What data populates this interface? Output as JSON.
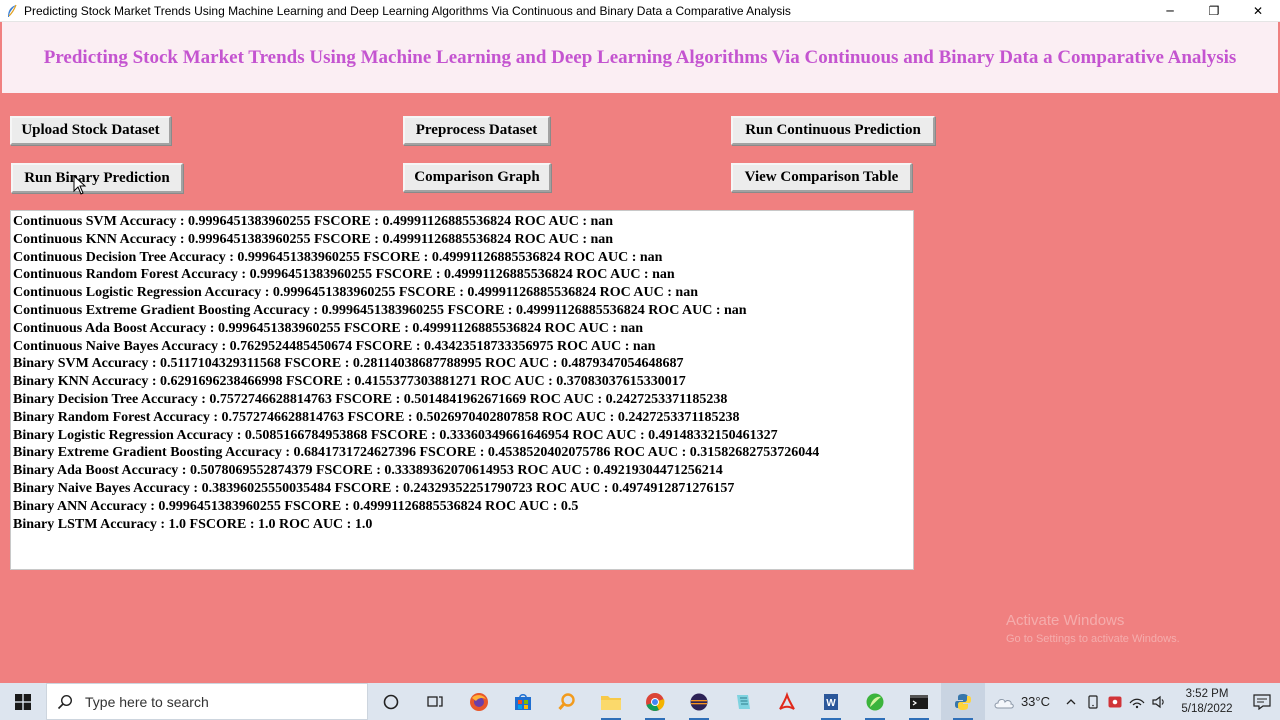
{
  "window": {
    "title": "Predicting Stock Market Trends Using Machine Learning and Deep Learning Algorithms Via Continuous and Binary Data a Comparative Analysis",
    "minimize": "─",
    "restore": "❐",
    "close": "✕"
  },
  "header": {
    "title": "Predicting Stock Market Trends Using Machine Learning and Deep Learning Algorithms Via Continuous and Binary Data a Comparative Analysis"
  },
  "buttons": {
    "upload": "Upload Stock Dataset",
    "preprocess": "Preprocess Dataset",
    "run_continuous": "Run Continuous Prediction",
    "run_binary": "Run Binary Prediction",
    "comparison_graph": "Comparison Graph",
    "comparison_table": "View Comparison Table"
  },
  "output": {
    "lines": [
      "Continuous SVM Accuracy : 0.9996451383960255 FSCORE : 0.49991126885536824 ROC AUC : nan",
      "Continuous KNN Accuracy : 0.9996451383960255 FSCORE : 0.49991126885536824 ROC AUC : nan",
      "Continuous Decision Tree Accuracy : 0.9996451383960255 FSCORE : 0.49991126885536824 ROC AUC : nan",
      "Continuous Random Forest Accuracy : 0.9996451383960255 FSCORE : 0.49991126885536824 ROC AUC : nan",
      "Continuous Logistic Regression Accuracy : 0.9996451383960255 FSCORE : 0.49991126885536824 ROC AUC : nan",
      "Continuous Extreme Gradient Boosting Accuracy : 0.9996451383960255 FSCORE : 0.49991126885536824 ROC AUC : nan",
      "Continuous Ada Boost Accuracy : 0.9996451383960255 FSCORE : 0.49991126885536824 ROC AUC : nan",
      "Continuous Naive Bayes Accuracy : 0.7629524485450674 FSCORE : 0.43423518733356975 ROC AUC : nan",
      "Binary SVM Accuracy : 0.5117104329311568 FSCORE : 0.28114038687788995 ROC AUC : 0.4879347054648687",
      "Binary KNN Accuracy : 0.6291696238466998 FSCORE : 0.4155377303881271 ROC AUC : 0.37083037615330017",
      "Binary Decision Tree Accuracy : 0.7572746628814763 FSCORE : 0.5014841962671669 ROC AUC : 0.2427253371185238",
      "Binary Random Forest Accuracy : 0.7572746628814763 FSCORE : 0.5026970402807858 ROC AUC : 0.2427253371185238",
      "Binary Logistic Regression Accuracy : 0.5085166784953868 FSCORE : 0.33360349661646954 ROC AUC : 0.49148332150461327",
      "Binary Extreme Gradient Boosting Accuracy : 0.6841731724627396 FSCORE : 0.4538520402075786 ROC AUC : 0.31582682753726044",
      "Binary Ada Boost Accuracy : 0.5078069552874379 FSCORE : 0.33389362070614953 ROC AUC : 0.49219304471256214",
      "Binary Naive Bayes Accuracy : 0.38396025550035484 FSCORE : 0.24329352251790723 ROC AUC : 0.4974912871276157",
      "Binary ANN Accuracy : 0.9996451383960255 FSCORE : 0.49991126885536824 ROC AUC : 0.5",
      "Binary LSTM Accuracy : 1.0 FSCORE : 1.0 ROC AUC : 1.0"
    ]
  },
  "watermark": {
    "line1": "Activate Windows",
    "line2": "Go to Settings to activate Windows."
  },
  "taskbar": {
    "search_placeholder": "Type here to search",
    "temperature": "33°C",
    "time": "3:52 PM",
    "date": "5/18/2022",
    "icons": [
      "cortana-icon",
      "task-view-icon",
      "firefox-icon",
      "store-icon",
      "search-tool-icon",
      "file-explorer-icon",
      "chrome-icon",
      "eclipse-icon",
      "notepad-icon",
      "acrobat-icon",
      "word-icon",
      "app-icon",
      "terminal-icon",
      "python-icon"
    ]
  },
  "colors": {
    "background": "#f08080",
    "header_bg": "#fbeef3",
    "header_text": "#c454d0"
  }
}
